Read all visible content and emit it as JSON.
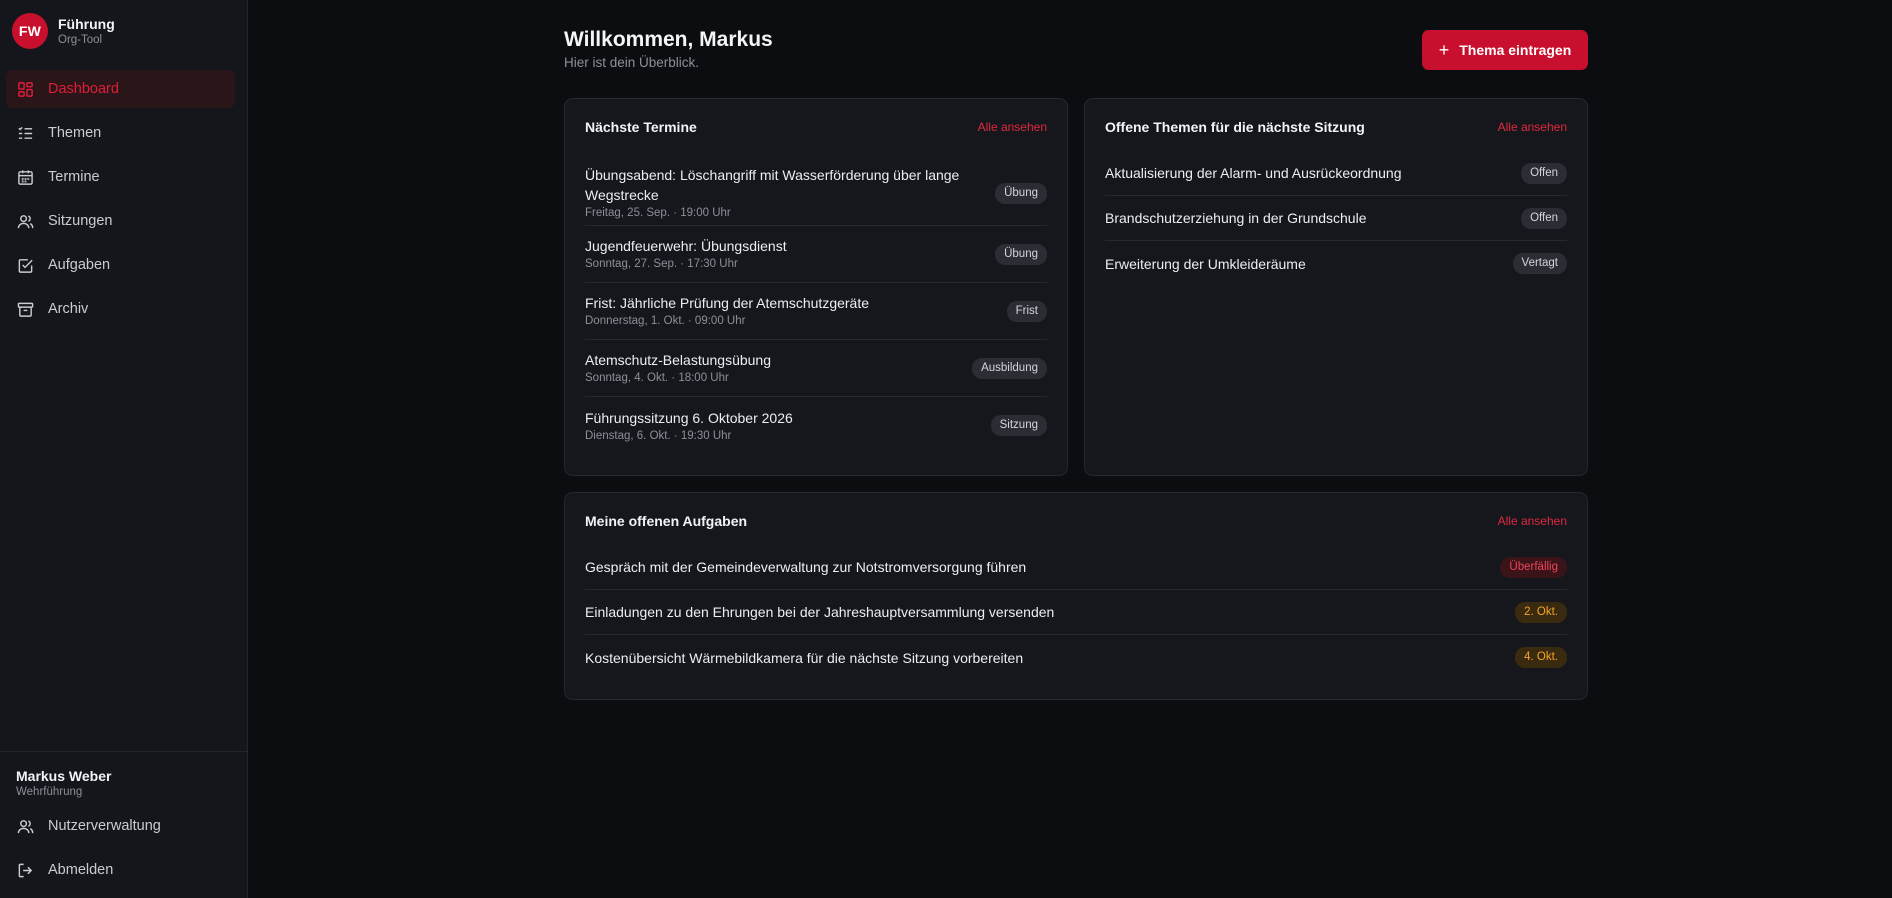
{
  "brand": {
    "logo": "FW",
    "title": "Führung",
    "subtitle": "Org-Tool"
  },
  "nav": [
    {
      "label": "Dashboard",
      "icon": "dashboard-icon",
      "active": true
    },
    {
      "label": "Themen",
      "icon": "list-check-icon"
    },
    {
      "label": "Termine",
      "icon": "calendar-icon"
    },
    {
      "label": "Sitzungen",
      "icon": "users-icon"
    },
    {
      "label": "Aufgaben",
      "icon": "checkbox-icon"
    },
    {
      "label": "Archiv",
      "icon": "archive-icon"
    }
  ],
  "user": {
    "name": "Markus Weber",
    "role": "Wehrführung"
  },
  "bottom_nav": [
    {
      "label": "Nutzerverwaltung",
      "icon": "users-icon"
    },
    {
      "label": "Abmelden",
      "icon": "logout-icon"
    }
  ],
  "header": {
    "title": "Willkommen, Markus",
    "subtitle": "Hier ist dein Überblick.",
    "cta": "Thema eintragen"
  },
  "colors": {
    "accent": "#c8102e",
    "background": "#0b0d11",
    "card": "#15171c",
    "overdue": "#ef4458",
    "due": "#f5a524"
  },
  "termine": {
    "title": "Nächste Termine",
    "link": "Alle ansehen",
    "items": [
      {
        "title": "Übungsabend: Löschangriff mit Wasserförderung über lange Wegstrecke",
        "date": "Freitag, 25. Sep. · 19:00 Uhr",
        "tag": "Übung"
      },
      {
        "title": "Jugendfeuerwehr: Übungsdienst",
        "date": "Sonntag, 27. Sep. · 17:30 Uhr",
        "tag": "Übung"
      },
      {
        "title": "Frist: Jährliche Prüfung der Atemschutzgeräte",
        "date": "Donnerstag, 1. Okt. · 09:00 Uhr",
        "tag": "Frist"
      },
      {
        "title": "Atemschutz-Belastungsübung",
        "date": "Sonntag, 4. Okt. · 18:00 Uhr",
        "tag": "Ausbildung"
      },
      {
        "title": "Führungssitzung 6. Oktober 2026",
        "date": "Dienstag, 6. Okt. · 19:30 Uhr",
        "tag": "Sitzung"
      }
    ]
  },
  "themen": {
    "title": "Offene Themen für die nächste Sitzung",
    "link": "Alle ansehen",
    "items": [
      {
        "title": "Aktualisierung der Alarm- und Ausrückeordnung",
        "status": "Offen"
      },
      {
        "title": "Brandschutzerziehung in der Grundschule",
        "status": "Offen"
      },
      {
        "title": "Erweiterung der Umkleideräume",
        "status": "Vertagt"
      }
    ]
  },
  "aufgaben": {
    "title": "Meine offenen Aufgaben",
    "link": "Alle ansehen",
    "items": [
      {
        "title": "Gespräch mit der Gemeindeverwaltung zur Notstromversorgung führen",
        "due": "Überfällig",
        "severity": "overdue"
      },
      {
        "title": "Einladungen zu den Ehrungen bei der Jahreshauptversammlung versenden",
        "due": "2. Okt.",
        "severity": "soon"
      },
      {
        "title": "Kostenübersicht Wärmebildkamera für die nächste Sitzung vorbereiten",
        "due": "4. Okt.",
        "severity": "soon"
      }
    ]
  }
}
